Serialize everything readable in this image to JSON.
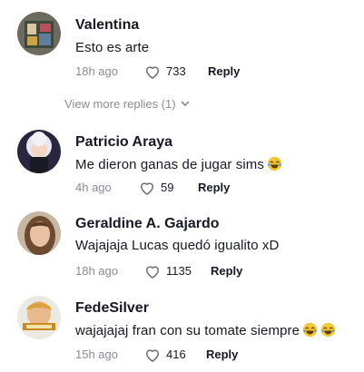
{
  "comments": [
    {
      "username": "Valentina",
      "text": "Esto es arte",
      "emoji": [],
      "time": "18h ago",
      "likes": "733",
      "reply_label": "Reply"
    },
    {
      "username": "Patricio Araya",
      "text": "Me dieron ganas de jugar sims",
      "emoji": [
        "face-with-tears-of-joy"
      ],
      "time": "4h ago",
      "likes": "59",
      "reply_label": "Reply"
    },
    {
      "username": "Geraldine A. Gajardo",
      "text": "Wajajaja Lucas quedó igualito xD",
      "emoji": [],
      "time": "18h ago",
      "likes": "1135",
      "reply_label": "Reply"
    },
    {
      "username": "FedeSilver",
      "text": "wajajajaj fran con su tomate siempre",
      "emoji": [
        "face-with-tears-of-joy",
        "face-with-tears-of-joy"
      ],
      "time": "15h ago",
      "likes": "416",
      "reply_label": "Reply"
    }
  ],
  "view_more_replies": "View more replies (1)",
  "icons": {
    "like": "heart-outline-icon",
    "expand": "chevron-down-icon"
  },
  "colors": {
    "text": "#161823",
    "muted": "#8a8b91"
  }
}
